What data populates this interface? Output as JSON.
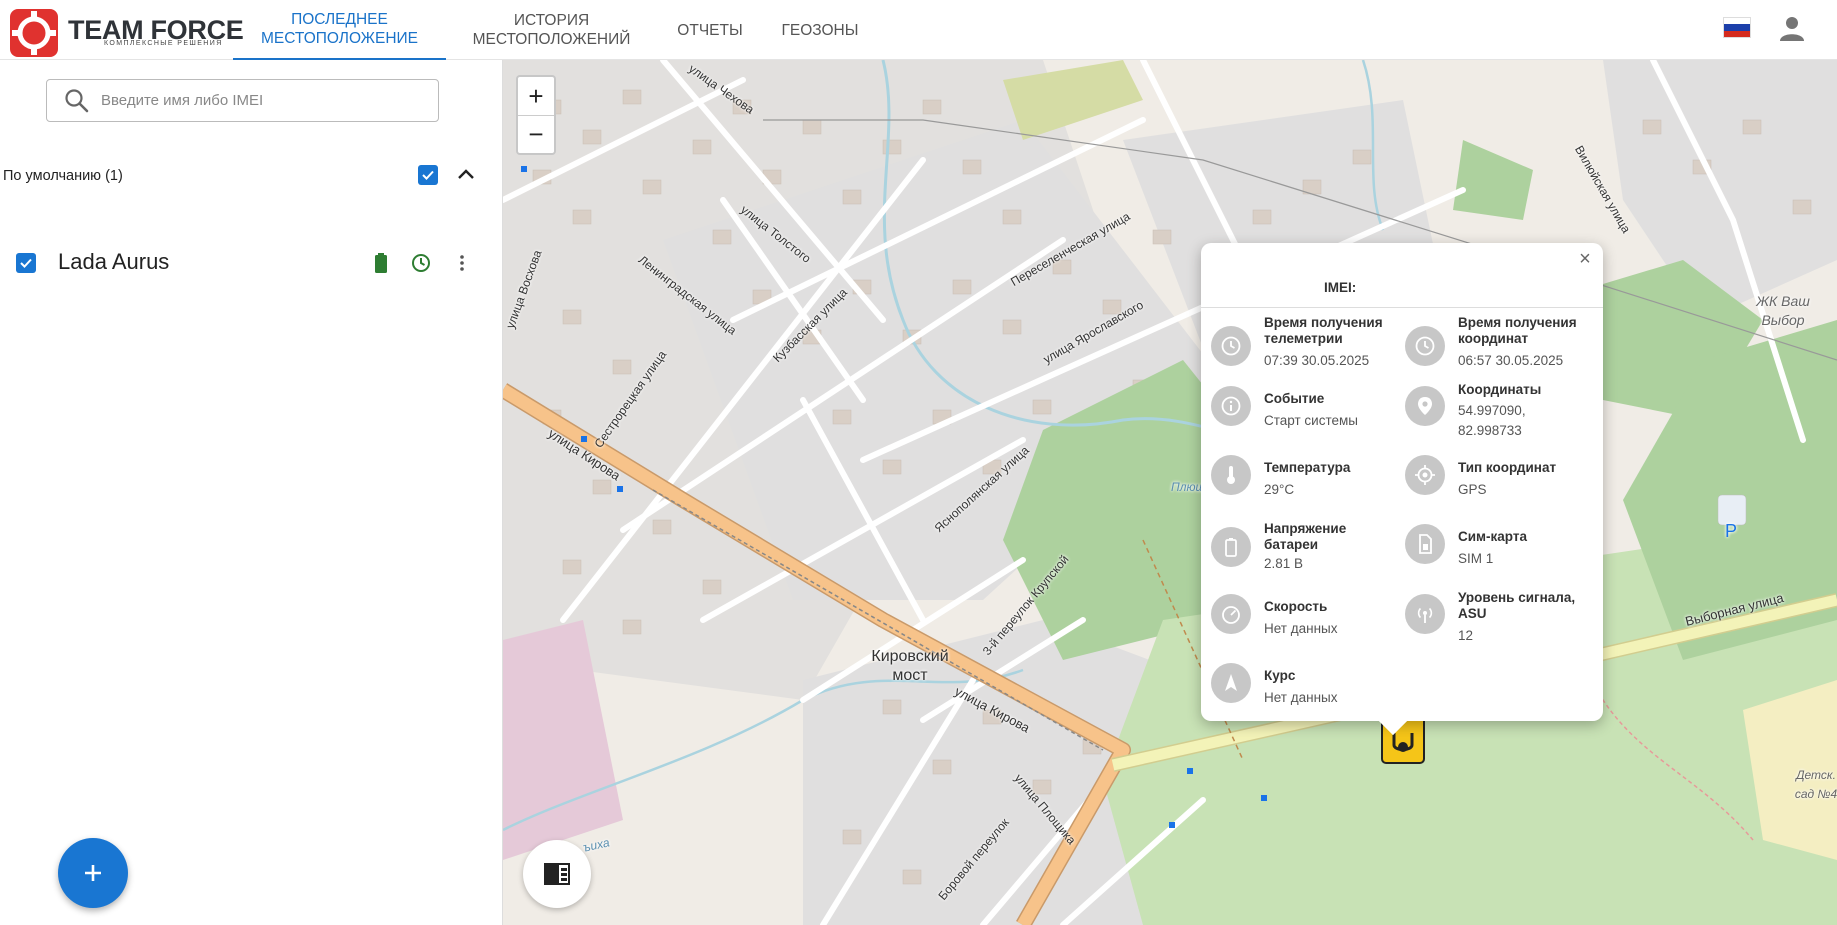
{
  "brand": {
    "title": "TEAM FORCE",
    "subtitle": "КОМПЛЕКСНЫЕ РЕШЕНИЯ"
  },
  "nav": {
    "items": [
      {
        "label": "ПОСЛЕДНЕЕ МЕСТОПОЛОЖЕНИЕ",
        "active": true
      },
      {
        "label": "ИСТОРИЯ МЕСТОПОЛОЖЕНИЙ",
        "active": false
      },
      {
        "label": "ОТЧЕТЫ",
        "active": false
      },
      {
        "label": "ГЕОЗОНЫ",
        "active": false
      }
    ]
  },
  "search": {
    "placeholder": "Введите имя либо IMEI",
    "value": ""
  },
  "group": {
    "label": "По умолчанию (1)",
    "checked": true
  },
  "devices": [
    {
      "name": "Lada Aurus",
      "checked": true
    }
  ],
  "map": {
    "labels": {
      "bridge": "Кировский мост",
      "complex": "ЖК Ваш Выбор",
      "kindergarten": "Детск. сад №4",
      "st_kirova": "улица Кирова",
      "st_kirova2": "улица Кирова",
      "st_vybornaya": "Выборная улица",
      "st_chekhova": "улица Чехова",
      "st_tolstogo": "улица Толстого",
      "st_leningradskaya": "Ленинградская улица",
      "st_kuzbasskaya": "Кузбасская улица",
      "st_pereselencheskaya": "Переселенческая улица",
      "st_yaroslavskogo": "улица Ярославского",
      "st_yasnopolyanskaya": "Яснополянская улица",
      "st_krupskoy": "3-й переулок Крупской",
      "st_vilyuyskaya": "Вилюйская улица",
      "st_sestroretskaya": "Сестрорецкая улица",
      "st_voskhova": "улица Восхова",
      "st_ploshchka": "улица Площика",
      "st_borovoy": "Боровой переулок",
      "river": "Плющиха",
      "river2": "ъиха"
    },
    "controls": {
      "zoom_in": "+",
      "zoom_out": "−"
    },
    "parking_label": "P"
  },
  "popup": {
    "imei_label": "IMEI:",
    "close_label": "×",
    "fields": {
      "telemetry_time": {
        "title": "Время получения телеметрии",
        "value": "07:39 30.05.2025"
      },
      "coords_time": {
        "title": "Время получения координат",
        "value": "06:57 30.05.2025"
      },
      "event": {
        "title": "Событие",
        "value": "Старт системы"
      },
      "coordinates": {
        "title": "Координаты",
        "value": "54.997090, 82.998733"
      },
      "temperature": {
        "title": "Температура",
        "value": "29°C"
      },
      "coord_type": {
        "title": "Тип координат",
        "value": "GPS"
      },
      "battery_voltage": {
        "title": "Напряжение батареи",
        "value": "2.81 В"
      },
      "sim": {
        "title": "Сим-карта",
        "value": "SIM 1"
      },
      "speed": {
        "title": "Скорость",
        "value": "Нет данных"
      },
      "signal": {
        "title": "Уровень сигнала, ASU",
        "value": "12"
      },
      "course": {
        "title": "Курс",
        "value": "Нет данных"
      }
    }
  },
  "colors": {
    "accent": "#1976d2",
    "nav_active": "#1a73c9",
    "brand_red": "#e0322f",
    "battery_green": "#2e7d32",
    "marker_yellow": "#f5c518",
    "icon_gray": "#c7c7c7",
    "map_park": "#add19e",
    "map_road_main": "#f7c38a",
    "map_residential": "#e0dfdf"
  },
  "icons": {
    "search": "search-icon",
    "user": "user-icon",
    "flag": "russia-flag-icon",
    "battery": "battery-icon",
    "clock": "clock-icon",
    "more": "more-vert-icon",
    "add": "plus-icon",
    "layers": "sidebar-toggle-icon",
    "chevron": "chevron-up-icon"
  }
}
